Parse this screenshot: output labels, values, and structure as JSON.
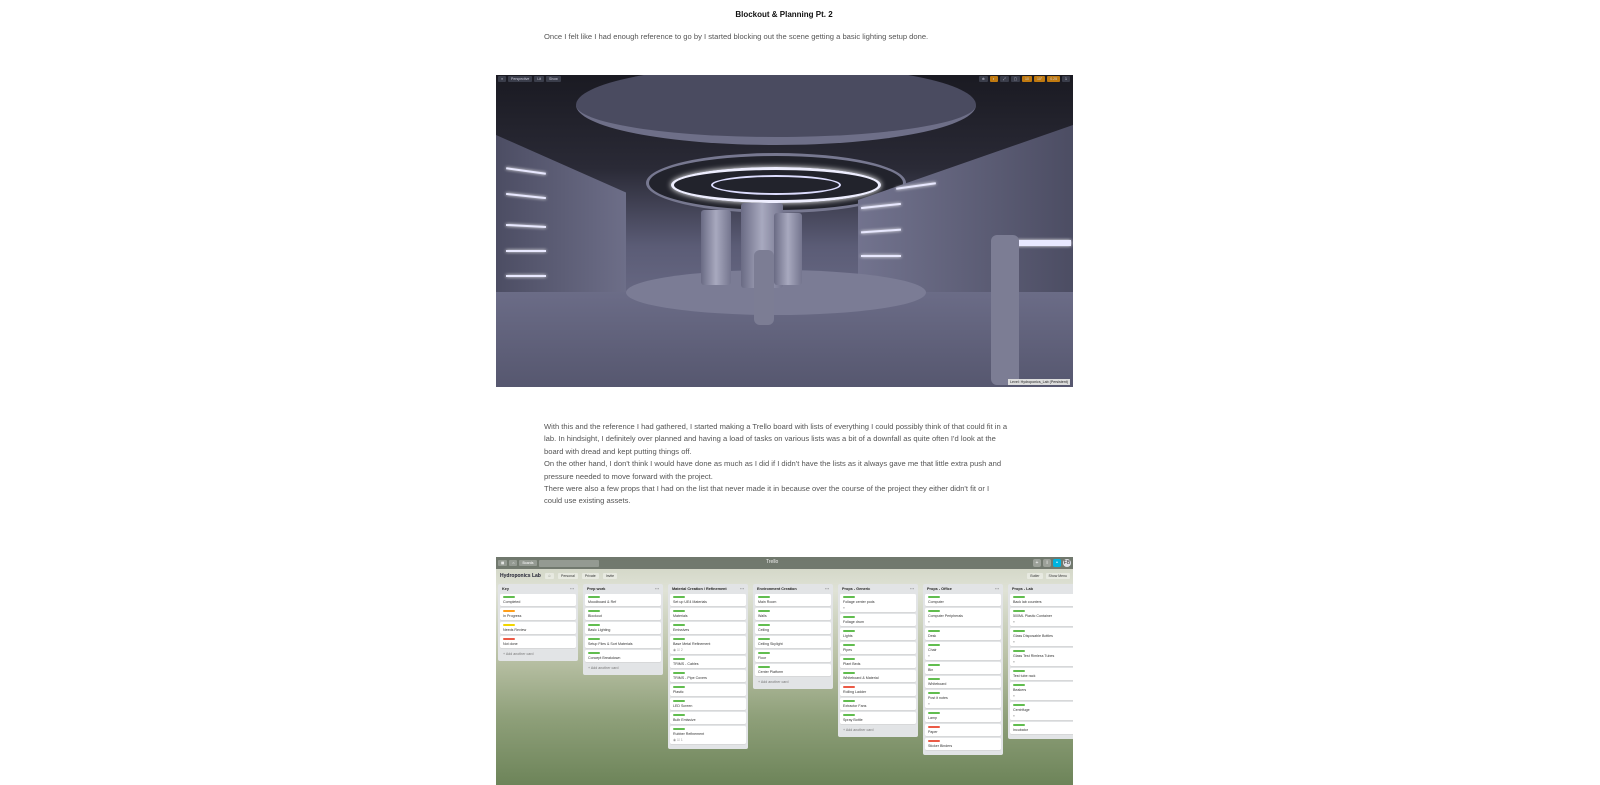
{
  "heading": "Blockout & Planning Pt. 2",
  "intro": "Once I felt like I had enough reference to go by I started blocking out the scene getting a basic lighting setup done.",
  "viewport": {
    "toolbar_left": [
      "≡",
      "Perspective",
      "Lit",
      "Show"
    ],
    "toolbar_right": [
      "⊕",
      "◐",
      "⤢",
      "▢",
      "10",
      "10°",
      "0.25",
      "1"
    ],
    "level_label": "Level: Hydroponics_Lab (Persistent)"
  },
  "body_lines": [
    "With this and the reference I had gathered, I started making a Trello board with lists of everything I could possibly think of that could fit in a",
    "lab. In hindsight, I definitely over planned and having a load of tasks on various lists was a bit of a downfall as quite often I'd look at the",
    "board with dread and kept putting things off.",
    "On the other hand, I don't think I would have done as much as I did if I didn't have the lists as it always gave me that little extra push and",
    "pressure needed to move forward with the project.",
    "There were also a few props that I had on the list that never made it in because over the course of the project they either didn't fit or I",
    "could use existing assets."
  ],
  "trello": {
    "topbar": {
      "boards": "Boards",
      "logo": "Trello",
      "avatar": "FB"
    },
    "board_name": "Hydroponics Lab",
    "personal": "Personal",
    "private": "Private",
    "invite": "Invite",
    "butler": "Butler",
    "menu": "Show Menu",
    "add_card": "+ Add another card",
    "colors": {
      "green": "#61bd4f",
      "orange": "#ff9f1a",
      "yellow": "#f2d600",
      "red": "#eb5a46"
    },
    "lists": [
      {
        "title": "Key",
        "add": true,
        "cards": [
          {
            "t": "Completed",
            "c": "green"
          },
          {
            "t": "In Progress",
            "c": "orange"
          },
          {
            "t": "Needs Review",
            "c": "yellow"
          },
          {
            "t": "Not done",
            "c": "red"
          }
        ]
      },
      {
        "title": "Prep work",
        "add": true,
        "cards": [
          {
            "t": "Moodboard & Ref",
            "c": "green"
          },
          {
            "t": "Blockout",
            "c": "green"
          },
          {
            "t": "Basic Lighting",
            "c": "green"
          },
          {
            "t": "Setup Files & Sort Materials",
            "c": "green"
          },
          {
            "t": "Concept Breakdown",
            "c": "green"
          }
        ]
      },
      {
        "title": "Material Creation / Refinement",
        "add": false,
        "cards": [
          {
            "t": "Set up UE4 Materials",
            "c": "green"
          },
          {
            "t": "Materials",
            "c": "green"
          },
          {
            "t": "Emissives",
            "c": "green"
          },
          {
            "t": "Base Metal Refinement",
            "c": "green",
            "b": "◉ ☑ 2"
          },
          {
            "t": "TRIMS - Cables",
            "c": "green"
          },
          {
            "t": "TRIMS - Pipe Covers",
            "c": "green"
          },
          {
            "t": "Plastic",
            "c": "green"
          },
          {
            "t": "LED Screen",
            "c": "green"
          },
          {
            "t": "Bulb Emissive",
            "c": "green"
          },
          {
            "t": "Rubber Refinement",
            "c": "green",
            "b": "◉ ☑ 1"
          }
        ]
      },
      {
        "title": "Environment Creation",
        "add": true,
        "cards": [
          {
            "t": "Main Room",
            "c": "green"
          },
          {
            "t": "Walls",
            "c": "green"
          },
          {
            "t": "Ceiling",
            "c": "green"
          },
          {
            "t": "Ceiling Skylight",
            "c": "green"
          },
          {
            "t": "Floor",
            "c": "green"
          },
          {
            "t": "Center Platform",
            "c": "green"
          }
        ]
      },
      {
        "title": "Props - Generic",
        "add": true,
        "cards": [
          {
            "t": "Foliage center pods",
            "c": "green",
            "b": "≡"
          },
          {
            "t": "Foliage drum",
            "c": "green"
          },
          {
            "t": "Lights",
            "c": "green"
          },
          {
            "t": "Pipes",
            "c": "green"
          },
          {
            "t": "Plant Beds",
            "c": "green"
          },
          {
            "t": "Whiteboard & Material",
            "c": "green"
          },
          {
            "t": "Rolling Ladder",
            "c": "red"
          },
          {
            "t": "Extractor Fans",
            "c": "green"
          },
          {
            "t": "Spray Bottle",
            "c": "green"
          }
        ]
      },
      {
        "title": "Props - Office",
        "add": false,
        "cards": [
          {
            "t": "Computer",
            "c": "green"
          },
          {
            "t": "Computer Peripherals",
            "c": "green",
            "b": "≡"
          },
          {
            "t": "Desk",
            "c": "green"
          },
          {
            "t": "Chair",
            "c": "green",
            "b": "≡"
          },
          {
            "t": "Bin",
            "c": "green"
          },
          {
            "t": "Whiteboard",
            "c": "green"
          },
          {
            "t": "Post it notes",
            "c": "green",
            "b": "≡"
          },
          {
            "t": "Lamp",
            "c": "green"
          },
          {
            "t": "Paper",
            "c": "red"
          },
          {
            "t": "Sticker Binders",
            "c": "red"
          }
        ]
      },
      {
        "title": "Props - Lab",
        "add": false,
        "cards": [
          {
            "t": "Back lab counters",
            "c": "green"
          },
          {
            "t": "500ML Plastic Container",
            "c": "green",
            "b": "≡"
          },
          {
            "t": "Glass Disposable Bottles",
            "c": "green",
            "b": "≡"
          },
          {
            "t": "Glass Test Rimless Tubes",
            "c": "green",
            "b": "≡"
          },
          {
            "t": "Test tube rack",
            "c": "green"
          },
          {
            "t": "Beakers",
            "c": "green",
            "b": "≡"
          },
          {
            "t": "Centrifuge",
            "c": "green",
            "b": "≡"
          },
          {
            "t": "Incubator",
            "c": "green"
          }
        ]
      }
    ]
  }
}
